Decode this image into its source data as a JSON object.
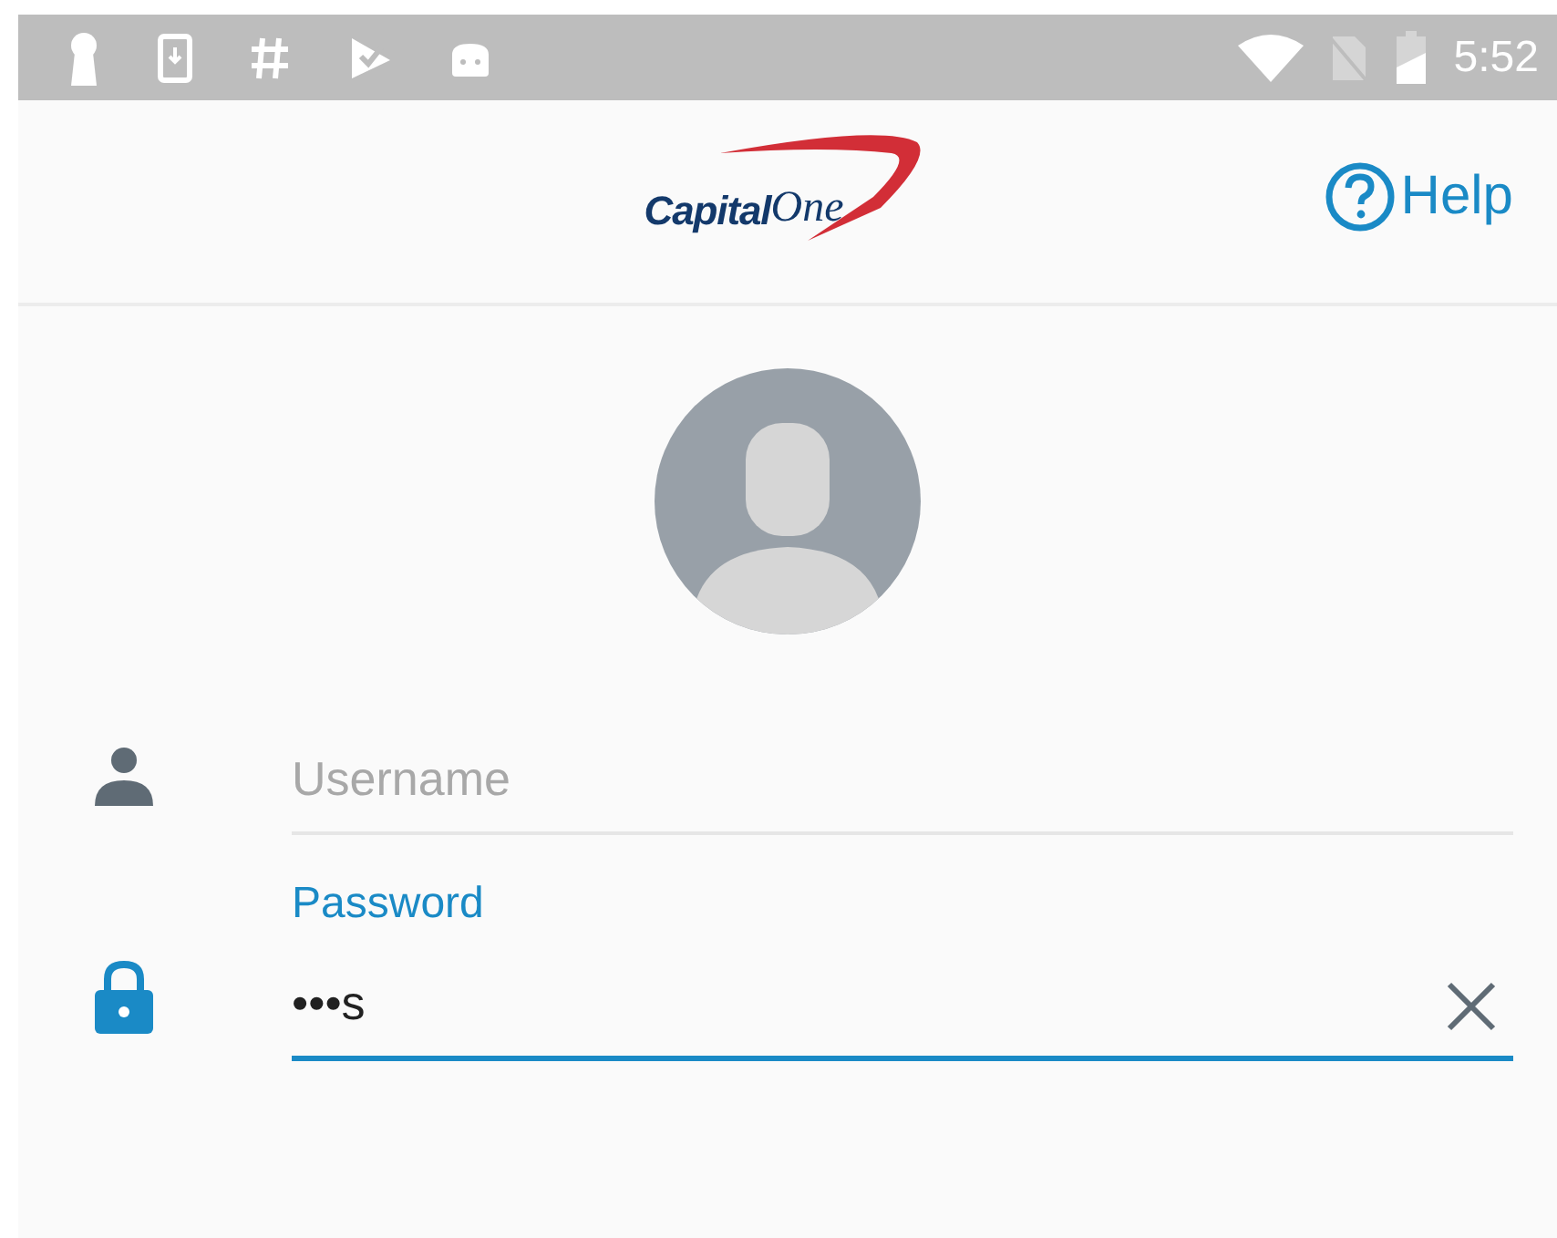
{
  "status_bar": {
    "time": "5:52"
  },
  "header": {
    "logo": {
      "word_1": "Capital",
      "word_2": "One"
    },
    "help": {
      "label": "Help"
    }
  },
  "fields": [
    {
      "kind": "username",
      "placeholder": "Username",
      "focused": false
    },
    {
      "kind": "password",
      "label": "Password",
      "value": "•••s",
      "focused": true
    }
  ]
}
